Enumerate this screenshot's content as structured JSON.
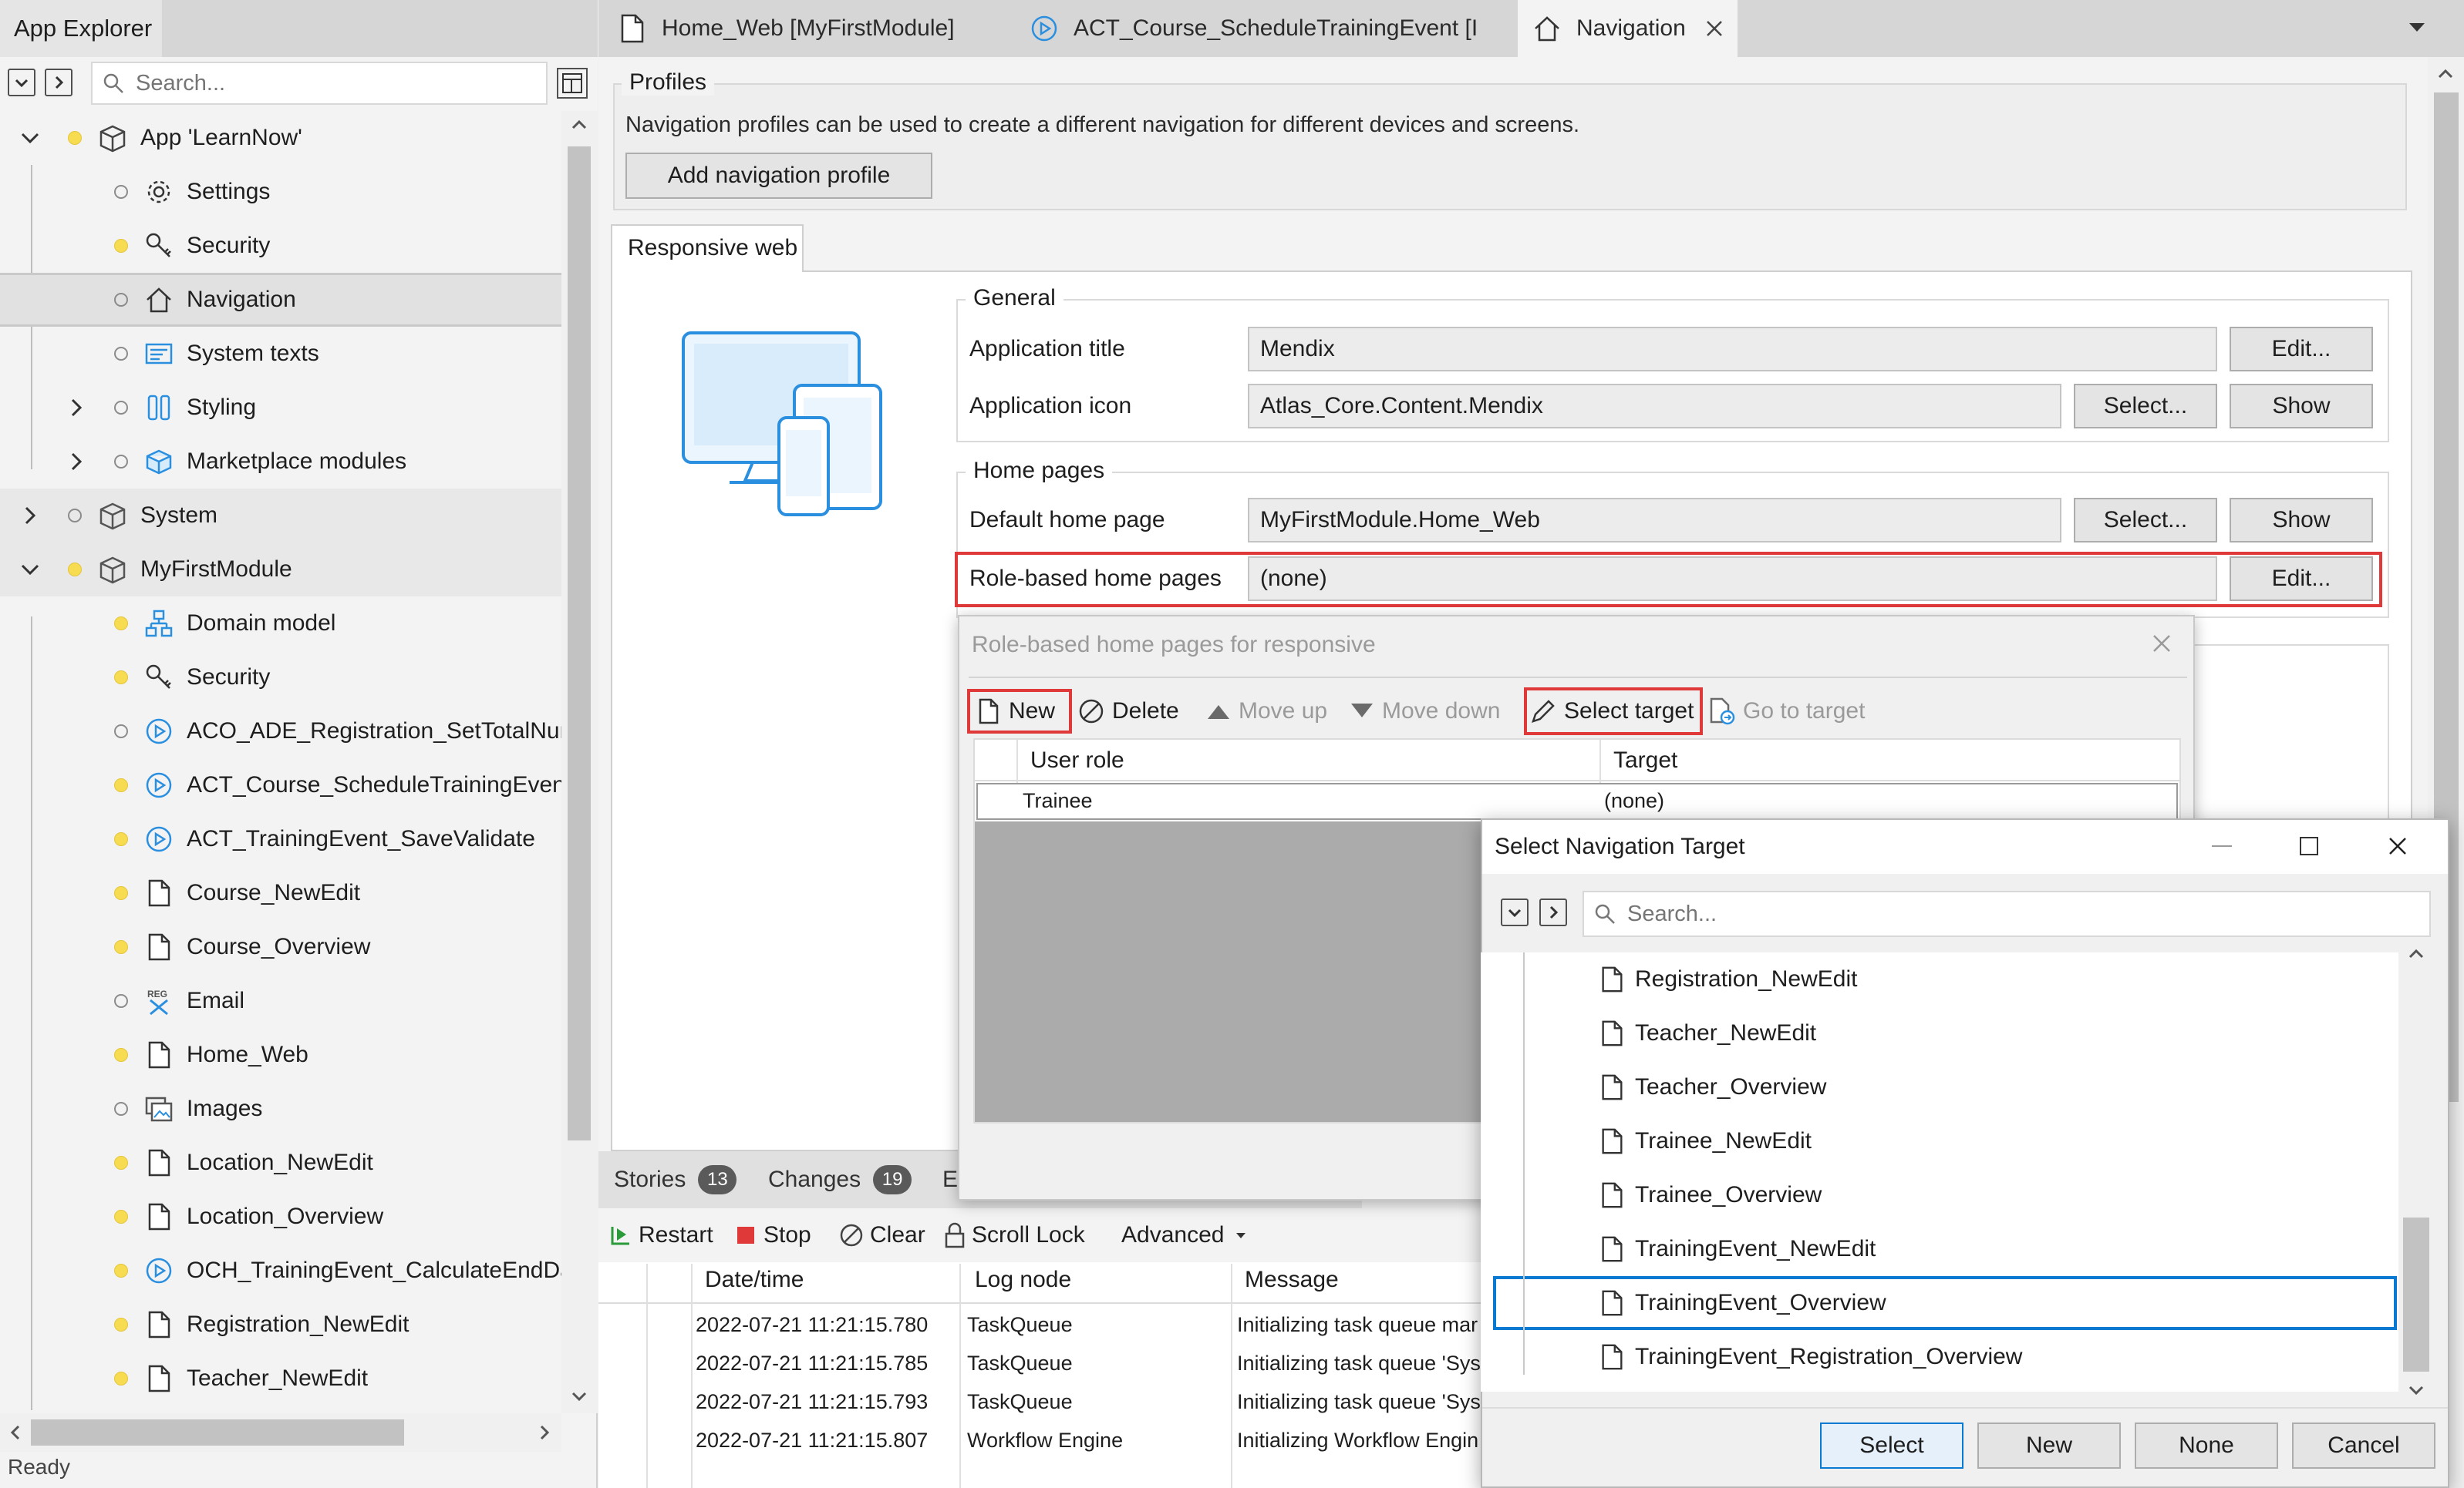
{
  "left": {
    "title": "App Explorer",
    "search_placeholder": "Search...",
    "tree": [
      {
        "label": "App 'LearnNow'",
        "icon": "box-icon",
        "dot": "y",
        "level": 0,
        "expand": "open"
      },
      {
        "label": "Settings",
        "icon": "gear-icon",
        "dot": "o",
        "level": 1
      },
      {
        "label": "Security",
        "icon": "key-icon",
        "dot": "y",
        "level": 1
      },
      {
        "label": "Navigation",
        "icon": "home-icon",
        "dot": "o",
        "level": 1,
        "selected": true
      },
      {
        "label": "System texts",
        "icon": "text-icon",
        "dot": "o",
        "level": 1
      },
      {
        "label": "Styling",
        "icon": "styling-icon",
        "dot": "o",
        "level": 1,
        "expand": "closed"
      },
      {
        "label": "Marketplace modules",
        "icon": "cube-icon",
        "dot": "o",
        "level": 1,
        "expand": "closed"
      },
      {
        "label": "System",
        "icon": "module-icon",
        "dot": "o",
        "level": 0,
        "expand": "closed",
        "section": true
      },
      {
        "label": "MyFirstModule",
        "icon": "module-icon",
        "dot": "y",
        "level": 0,
        "expand": "open",
        "section": true
      },
      {
        "label": "Domain model",
        "icon": "domain-model-icon",
        "dot": "y",
        "level": 1
      },
      {
        "label": "Security",
        "icon": "key-icon",
        "dot": "y",
        "level": 1
      },
      {
        "label": "ACO_ADE_Registration_SetTotalNumb",
        "icon": "microflow-icon",
        "dot": "o",
        "level": 1
      },
      {
        "label": "ACT_Course_ScheduleTrainingEvent",
        "icon": "microflow-icon",
        "dot": "y",
        "level": 1
      },
      {
        "label": "ACT_TrainingEvent_SaveValidate",
        "icon": "microflow-icon",
        "dot": "y",
        "level": 1
      },
      {
        "label": "Course_NewEdit",
        "icon": "page-icon",
        "dot": "y",
        "level": 1
      },
      {
        "label": "Course_Overview",
        "icon": "page-icon",
        "dot": "y",
        "level": 1
      },
      {
        "label": "Email",
        "icon": "regex-icon",
        "dot": "o",
        "level": 1
      },
      {
        "label": "Home_Web",
        "icon": "page-icon",
        "dot": "y",
        "level": 1
      },
      {
        "label": "Images",
        "icon": "images-icon",
        "dot": "o",
        "level": 1
      },
      {
        "label": "Location_NewEdit",
        "icon": "page-icon",
        "dot": "y",
        "level": 1
      },
      {
        "label": "Location_Overview",
        "icon": "page-icon",
        "dot": "y",
        "level": 1
      },
      {
        "label": "OCH_TrainingEvent_CalculateEndDate",
        "icon": "microflow-icon",
        "dot": "y",
        "level": 1
      },
      {
        "label": "Registration_NewEdit",
        "icon": "page-icon",
        "dot": "y",
        "level": 1
      },
      {
        "label": "Teacher_NewEdit",
        "icon": "page-icon",
        "dot": "y",
        "level": 1
      }
    ],
    "status": "Ready"
  },
  "tabs": [
    {
      "label": "Home_Web [MyFirstModule]",
      "icon": "page-icon"
    },
    {
      "label": "ACT_Course_ScheduleTrainingEvent [I",
      "icon": "microflow-icon"
    },
    {
      "label": "Navigation",
      "icon": "home-icon",
      "active": true
    }
  ],
  "profiles": {
    "legend": "Profiles",
    "description": "Navigation profiles can be used to create a different navigation for different devices and screens.",
    "add_button": "Add navigation profile"
  },
  "responsive": {
    "tab_label": "Responsive web",
    "general_legend": "General",
    "app_title_label": "Application title",
    "app_title_value": "Mendix",
    "app_title_edit": "Edit...",
    "app_icon_label": "Application icon",
    "app_icon_value": "Atlas_Core.Content.Mendix",
    "app_icon_select": "Select...",
    "app_icon_show": "Show",
    "home_legend": "Home pages",
    "default_home_label": "Default home page",
    "default_home_value": "MyFirstModule.Home_Web",
    "default_home_select": "Select...",
    "default_home_show": "Show",
    "role_home_label": "Role-based home pages",
    "role_home_value": "(none)",
    "role_home_edit": "Edit..."
  },
  "bottom": {
    "tabs": [
      {
        "label": "Stories",
        "count": "13"
      },
      {
        "label": "Changes",
        "count": "19"
      },
      {
        "label": "Er"
      }
    ],
    "toolbar": {
      "restart": "Restart",
      "stop": "Stop",
      "clear": "Clear",
      "scroll_lock": "Scroll Lock",
      "advanced": "Advanced"
    },
    "columns": [
      "Date/time",
      "Log node",
      "Message"
    ],
    "rows": [
      [
        "2022-07-21 11:21:15.780",
        "TaskQueue",
        "Initializing task queue mar"
      ],
      [
        "2022-07-21 11:21:15.785",
        "TaskQueue",
        "Initializing task queue 'Sys"
      ],
      [
        "2022-07-21 11:21:15.793",
        "TaskQueue",
        "Initializing task queue 'Sys"
      ],
      [
        "2022-07-21 11:21:15.807",
        "Workflow Engine",
        "Initializing Workflow Engin"
      ]
    ]
  },
  "role_dialog": {
    "title": "Role-based home pages for responsive",
    "toolbar": {
      "new": "New",
      "delete": "Delete",
      "move_up": "Move up",
      "move_down": "Move down",
      "select_target": "Select target",
      "go_to_target": "Go to target"
    },
    "columns": [
      "User role",
      "Target"
    ],
    "rows": [
      [
        "Trainee",
        "(none)"
      ]
    ]
  },
  "select_dialog": {
    "title": "Select Navigation Target",
    "search_placeholder": "Search...",
    "items": [
      {
        "label": "Registration_NewEdit"
      },
      {
        "label": "Teacher_NewEdit"
      },
      {
        "label": "Teacher_Overview"
      },
      {
        "label": "Trainee_NewEdit"
      },
      {
        "label": "Trainee_Overview"
      },
      {
        "label": "TrainingEvent_NewEdit"
      },
      {
        "label": "TrainingEvent_Overview",
        "selected": true
      },
      {
        "label": "TrainingEvent_Registration_Overview"
      }
    ],
    "buttons": {
      "select": "Select",
      "new": "New",
      "none": "None",
      "cancel": "Cancel"
    }
  },
  "colors": {
    "highlight": "#e0393a",
    "selection": "#0a79d1",
    "accent_icon": "#2b8fe0",
    "dot_active": "#f7dc52"
  }
}
